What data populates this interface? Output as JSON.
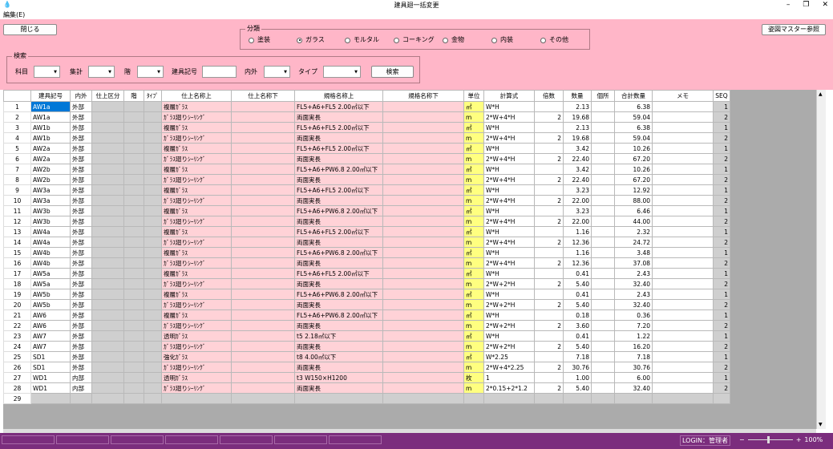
{
  "window": {
    "title": "建具廻一括変更"
  },
  "menu": {
    "edit": "編集(E)"
  },
  "toolbar": {
    "close": "閉じる",
    "master": "姿図マスター参照"
  },
  "category": {
    "label": "分類",
    "options": [
      "塗装",
      "ガラス",
      "モルタル",
      "コーキング",
      "金物",
      "内装",
      "その他"
    ],
    "selected": "ガラス"
  },
  "search": {
    "group": "検索",
    "floor_label": "科目",
    "sum_label": "集計",
    "level_label": "階",
    "code_label": "建具記号",
    "inout_label": "内外",
    "type_label": "タイプ",
    "button": "検索"
  },
  "table": {
    "headers": [
      "建具記号",
      "内外",
      "仕上区分",
      "階",
      "ﾀｲﾌﾟ",
      "仕上名称上",
      "仕上名称下",
      "規格名称上",
      "規格名称下",
      "単位",
      "計算式",
      "倍数",
      "数量",
      "個所",
      "合計数量",
      "メモ",
      "SEQ"
    ],
    "rows": [
      [
        "1",
        "AW1a",
        "外部",
        "",
        "",
        "",
        "複層ｶﾞﾗｽ",
        "",
        "FL5+A6+FL5 2.00㎡以下",
        "",
        "㎡",
        "W*H",
        "",
        "2.13",
        "",
        "6.38",
        "",
        "1"
      ],
      [
        "2",
        "AW1a",
        "外部",
        "",
        "",
        "",
        "ｶﾞﾗｽ廻りｼｰﾘﾝｸﾞ",
        "",
        "両面実長",
        "",
        "m",
        "2*W+4*H",
        "2",
        "19.68",
        "",
        "59.04",
        "",
        "2"
      ],
      [
        "3",
        "AW1b",
        "外部",
        "",
        "",
        "",
        "複層ｶﾞﾗｽ",
        "",
        "FL5+A6+FL5 2.00㎡以下",
        "",
        "㎡",
        "W*H",
        "",
        "2.13",
        "",
        "6.38",
        "",
        "1"
      ],
      [
        "4",
        "AW1b",
        "外部",
        "",
        "",
        "",
        "ｶﾞﾗｽ廻りｼｰﾘﾝｸﾞ",
        "",
        "両面実長",
        "",
        "m",
        "2*W+4*H",
        "2",
        "19.68",
        "",
        "59.04",
        "",
        "2"
      ],
      [
        "5",
        "AW2a",
        "外部",
        "",
        "",
        "",
        "複層ｶﾞﾗｽ",
        "",
        "FL5+A6+FL5 2.00㎡以下",
        "",
        "㎡",
        "W*H",
        "",
        "3.42",
        "",
        "10.26",
        "",
        "1"
      ],
      [
        "6",
        "AW2a",
        "外部",
        "",
        "",
        "",
        "ｶﾞﾗｽ廻りｼｰﾘﾝｸﾞ",
        "",
        "両面実長",
        "",
        "m",
        "2*W+4*H",
        "2",
        "22.40",
        "",
        "67.20",
        "",
        "2"
      ],
      [
        "7",
        "AW2b",
        "外部",
        "",
        "",
        "",
        "複層ｶﾞﾗｽ",
        "",
        "FL5+A6+PW6.8 2.00㎡以下",
        "",
        "㎡",
        "W*H",
        "",
        "3.42",
        "",
        "10.26",
        "",
        "1"
      ],
      [
        "8",
        "AW2b",
        "外部",
        "",
        "",
        "",
        "ｶﾞﾗｽ廻りｼｰﾘﾝｸﾞ",
        "",
        "両面実長",
        "",
        "m",
        "2*W+4*H",
        "2",
        "22.40",
        "",
        "67.20",
        "",
        "2"
      ],
      [
        "9",
        "AW3a",
        "外部",
        "",
        "",
        "",
        "複層ｶﾞﾗｽ",
        "",
        "FL5+A6+FL5 2.00㎡以下",
        "",
        "㎡",
        "W*H",
        "",
        "3.23",
        "",
        "12.92",
        "",
        "1"
      ],
      [
        "10",
        "AW3a",
        "外部",
        "",
        "",
        "",
        "ｶﾞﾗｽ廻りｼｰﾘﾝｸﾞ",
        "",
        "両面実長",
        "",
        "m",
        "2*W+4*H",
        "2",
        "22.00",
        "",
        "88.00",
        "",
        "2"
      ],
      [
        "11",
        "AW3b",
        "外部",
        "",
        "",
        "",
        "複層ｶﾞﾗｽ",
        "",
        "FL5+A6+PW6.8 2.00㎡以下",
        "",
        "㎡",
        "W*H",
        "",
        "3.23",
        "",
        "6.46",
        "",
        "1"
      ],
      [
        "12",
        "AW3b",
        "外部",
        "",
        "",
        "",
        "ｶﾞﾗｽ廻りｼｰﾘﾝｸﾞ",
        "",
        "両面実長",
        "",
        "m",
        "2*W+4*H",
        "2",
        "22.00",
        "",
        "44.00",
        "",
        "2"
      ],
      [
        "13",
        "AW4a",
        "外部",
        "",
        "",
        "",
        "複層ｶﾞﾗｽ",
        "",
        "FL5+A6+FL5 2.00㎡以下",
        "",
        "㎡",
        "W*H",
        "",
        "1.16",
        "",
        "2.32",
        "",
        "1"
      ],
      [
        "14",
        "AW4a",
        "外部",
        "",
        "",
        "",
        "ｶﾞﾗｽ廻りｼｰﾘﾝｸﾞ",
        "",
        "両面実長",
        "",
        "m",
        "2*W+4*H",
        "2",
        "12.36",
        "",
        "24.72",
        "",
        "2"
      ],
      [
        "15",
        "AW4b",
        "外部",
        "",
        "",
        "",
        "複層ｶﾞﾗｽ",
        "",
        "FL5+A6+PW6.8 2.00㎡以下",
        "",
        "㎡",
        "W*H",
        "",
        "1.16",
        "",
        "3.48",
        "",
        "1"
      ],
      [
        "16",
        "AW4b",
        "外部",
        "",
        "",
        "",
        "ｶﾞﾗｽ廻りｼｰﾘﾝｸﾞ",
        "",
        "両面実長",
        "",
        "m",
        "2*W+4*H",
        "2",
        "12.36",
        "",
        "37.08",
        "",
        "2"
      ],
      [
        "17",
        "AW5a",
        "外部",
        "",
        "",
        "",
        "複層ｶﾞﾗｽ",
        "",
        "FL5+A6+FL5 2.00㎡以下",
        "",
        "㎡",
        "W*H",
        "",
        "0.41",
        "",
        "2.43",
        "",
        "1"
      ],
      [
        "18",
        "AW5a",
        "外部",
        "",
        "",
        "",
        "ｶﾞﾗｽ廻りｼｰﾘﾝｸﾞ",
        "",
        "両面実長",
        "",
        "m",
        "2*W+2*H",
        "2",
        "5.40",
        "",
        "32.40",
        "",
        "2"
      ],
      [
        "19",
        "AW5b",
        "外部",
        "",
        "",
        "",
        "複層ｶﾞﾗｽ",
        "",
        "FL5+A6+PW6.8 2.00㎡以下",
        "",
        "㎡",
        "W*H",
        "",
        "0.41",
        "",
        "2.43",
        "",
        "1"
      ],
      [
        "20",
        "AW5b",
        "外部",
        "",
        "",
        "",
        "ｶﾞﾗｽ廻りｼｰﾘﾝｸﾞ",
        "",
        "両面実長",
        "",
        "m",
        "2*W+2*H",
        "2",
        "5.40",
        "",
        "32.40",
        "",
        "2"
      ],
      [
        "21",
        "AW6",
        "外部",
        "",
        "",
        "",
        "複層ｶﾞﾗｽ",
        "",
        "FL5+A6+PW6.8 2.00㎡以下",
        "",
        "㎡",
        "W*H",
        "",
        "0.18",
        "",
        "0.36",
        "",
        "1"
      ],
      [
        "22",
        "AW6",
        "外部",
        "",
        "",
        "",
        "ｶﾞﾗｽ廻りｼｰﾘﾝｸﾞ",
        "",
        "両面実長",
        "",
        "m",
        "2*W+2*H",
        "2",
        "3.60",
        "",
        "7.20",
        "",
        "2"
      ],
      [
        "23",
        "AW7",
        "外部",
        "",
        "",
        "",
        "透明ｶﾞﾗｽ",
        "",
        "t5 2.18㎡以下",
        "",
        "㎡",
        "W*H",
        "",
        "0.41",
        "",
        "1.22",
        "",
        "1"
      ],
      [
        "24",
        "AW7",
        "外部",
        "",
        "",
        "",
        "ｶﾞﾗｽ廻りｼｰﾘﾝｸﾞ",
        "",
        "両面実長",
        "",
        "m",
        "2*W+2*H",
        "2",
        "5.40",
        "",
        "16.20",
        "",
        "2"
      ],
      [
        "25",
        "SD1",
        "外部",
        "",
        "",
        "",
        "強化ｶﾞﾗｽ",
        "",
        "t8 4.00㎡以下",
        "",
        "㎡",
        "W*2.25",
        "",
        "7.18",
        "",
        "7.18",
        "",
        "1"
      ],
      [
        "26",
        "SD1",
        "外部",
        "",
        "",
        "",
        "ｶﾞﾗｽ廻りｼｰﾘﾝｸﾞ",
        "",
        "両面実長",
        "",
        "m",
        "2*W+4*2.25",
        "2",
        "30.76",
        "",
        "30.76",
        "",
        "2"
      ],
      [
        "27",
        "WD1",
        "内部",
        "",
        "",
        "",
        "透明ｶﾞﾗｽ",
        "",
        "t3 W150×H1200",
        "",
        "枚",
        "1",
        "",
        "1.00",
        "",
        "6.00",
        "",
        "1"
      ],
      [
        "28",
        "WD1",
        "内部",
        "",
        "",
        "",
        "ｶﾞﾗｽ廻りｼｰﾘﾝｸﾞ",
        "",
        "両面実長",
        "",
        "m",
        "2*0.15+2*1.2",
        "2",
        "5.40",
        "",
        "32.40",
        "",
        "2"
      ],
      [
        "29",
        "",
        "",
        "",
        "",
        "",
        "",
        "",
        "",
        "",
        "",
        "",
        "",
        "",
        "",
        "",
        "",
        ""
      ]
    ]
  },
  "status": {
    "login": "LOGIN：管理者",
    "zoom": "100%"
  },
  "colors": {
    "pink_bg": "#ffb6c8",
    "pink_cell": "#ffd2d7",
    "yellow_cell": "#ffff80",
    "status_bar": "#7b2d7d",
    "selection": "#0078d7"
  }
}
